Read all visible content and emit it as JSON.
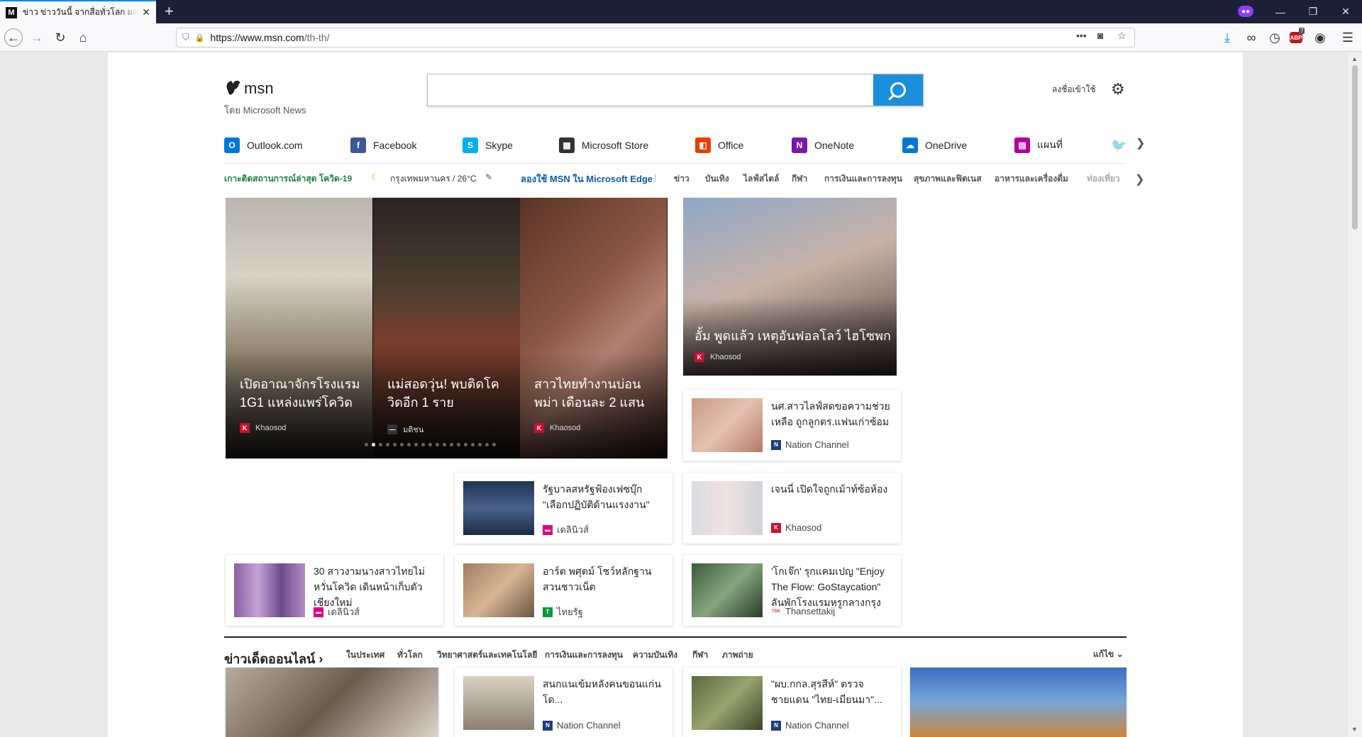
{
  "browser": {
    "tab_title": "ข่าว ข่าววันนี้ จากสื่อทั่วโลก ผลบอล",
    "tab_favicon": "msn-icon",
    "new_tab": "+",
    "url_domain": "https://www.msn.com",
    "url_path": "/th-th/",
    "abp_count": "7"
  },
  "header": {
    "logo_text": "msn",
    "byline": "โดย Microsoft News",
    "search_placeholder": "",
    "signin": "ลงชื่อเข้าใช้"
  },
  "apps": [
    {
      "label": "Outlook.com",
      "icon": "outlook-icon",
      "color": "#0078d4",
      "glyph": "O"
    },
    {
      "label": "Facebook",
      "icon": "facebook-icon",
      "color": "#3b5998",
      "glyph": "f"
    },
    {
      "label": "Skype",
      "icon": "skype-icon",
      "color": "#00aff0",
      "glyph": "S"
    },
    {
      "label": "Microsoft Store",
      "icon": "store-icon",
      "color": "#333333",
      "glyph": "▦"
    },
    {
      "label": "Office",
      "icon": "office-icon",
      "color": "#eb3c00",
      "glyph": "◧"
    },
    {
      "label": "OneNote",
      "icon": "onenote-icon",
      "color": "#7719aa",
      "glyph": "N"
    },
    {
      "label": "OneDrive",
      "icon": "onedrive-icon",
      "color": "#0078d4",
      "glyph": "☁"
    },
    {
      "label": "แผนที่",
      "icon": "maps-icon",
      "color": "#b4009e",
      "glyph": "▤"
    }
  ],
  "catbar": {
    "covid": "เกาะติดสถานการณ์ล่าสุด โควิด-19",
    "weather": "กรุงเทพมหานคร / 26°C",
    "edge": "ลองใช้ MSN ใน Microsoft Edge",
    "categories": [
      "ข่าว",
      "บันเทิง",
      "ไลฟ์สไตล์",
      "กีฬา",
      "การเงินและการลงทุน",
      "สุขภาพและฟิตเนส",
      "อาหารและเครื่องดื่ม",
      "ท่องเที่ยว"
    ]
  },
  "carousel": [
    {
      "caption": "เปิดอาณาจักรโรงแรม 1G1 แหล่งแพร่โควิด",
      "source": "Khaosod"
    },
    {
      "caption": "แม่สอดวุ่น! พบติดโควิดอีก 1 ราย",
      "source": "มติชน"
    },
    {
      "caption": "สาวไทยทำงานบ่อนพม่า เดือนละ 2 แสน",
      "source": "Khaosod"
    }
  ],
  "carousel_dot_count": 19,
  "carousel_active_dot": 1,
  "hero": {
    "caption": "อั้ม พูดแล้ว เหตุอันฟอลโลว์ ไฮโซพก",
    "source": "Khaosod"
  },
  "cards": [
    {
      "title": "นศ.สาวไลฟ์สดขอความช่วยเหลือ ถูกลูกตร.แฟนเก่าซ้อม",
      "source": "Nation Channel"
    },
    {
      "title": "รัฐบาลสหรัฐฟ้องเฟซบุ๊ก \"เลือกปฏิบัติด้านแรงงาน\"",
      "source": "เดลินิวส์"
    },
    {
      "title": "เจนนี่ เปิดใจถูกเม้าท์ซ้อห้อง",
      "source": "Khaosod"
    },
    {
      "title": "30 สาวงามนางสาวไทยไม่หวั่นโควิด เดินหน้าเก็บตัวเชียงใหม่",
      "source": "เดลินิวส์"
    },
    {
      "title": "อาร์ต พศุตม์ โชว์หลักฐานสวนชาวเน็ต",
      "source": "ไทยรัฐ"
    },
    {
      "title": "'โกเจ๊ก' รุกแคมเปญ \"Enjoy The Flow: GoStaycation\" ลันพักโรงแรมหรูกลางกรุง",
      "source": "Thansettakij"
    }
  ],
  "section": {
    "title": "ข่าวเด็ดออนไลน์",
    "subcats": [
      "ในประเทศ",
      "ทั่วโลก",
      "วิทยาศาสตร์และเทคโนโลยี",
      "การเงินและการลงทุน",
      "ความบันเทิง",
      "กีฬา",
      "ภาพถ่าย"
    ],
    "more": "แก้ไข"
  },
  "bottom_cards": [
    {
      "title": "สนกแนเข้มหลังคนขอนแก่นโด...",
      "source": "Nation Channel"
    },
    {
      "title": "\"ผบ.กกล.สุรสีห์\" ตรวจชายแดน \"ไทย-เมียนมา\"...",
      "source": "Nation Channel"
    }
  ]
}
